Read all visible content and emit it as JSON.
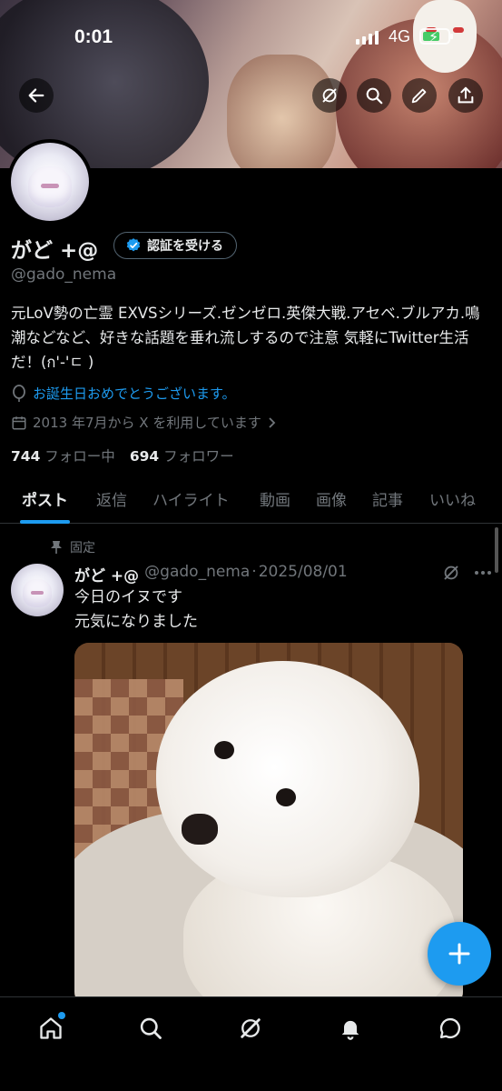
{
  "status_bar": {
    "time": "0:01",
    "network": "4G"
  },
  "profile": {
    "name": "がど +@",
    "verify_label": "認証を受ける",
    "handle": "@gado_nema",
    "bio": "元LoV勢の亡霊 EXVSシリーズ.ゼンゼロ.英傑大戦.アセベ.ブルアカ.鳴潮などなど、好きな話題を垂れ流しするので注意 気軽にTwitter生活だ！(ก'-'ㄷ )",
    "birthday": "お誕生日おめでとうございます。",
    "joined": "2013 年7月から X を利用しています",
    "following_count": "744",
    "following_label": "フォロー中",
    "followers_count": "694",
    "followers_label": "フォロワー"
  },
  "tabs": [
    {
      "label": "ポスト",
      "active": true
    },
    {
      "label": "返信"
    },
    {
      "label": "ハイライト"
    },
    {
      "label": "動画"
    },
    {
      "label": "画像"
    },
    {
      "label": "記事"
    },
    {
      "label": "いいね"
    }
  ],
  "post": {
    "pinned_label": "固定",
    "author": "がど +@",
    "handle": "@gado_nema",
    "separator": "·",
    "date": "2025/08/01",
    "text_line1": "今日のイヌです",
    "text_line2": "元気になりました"
  },
  "colors": {
    "accent": "#1d9bf0",
    "background": "#000000",
    "muted": "#71767b"
  },
  "icons": [
    "back-arrow-icon",
    "grok-icon",
    "search-icon",
    "edit-icon",
    "share-icon",
    "pin-icon",
    "more-icon",
    "home-icon",
    "notifications-icon",
    "messages-icon",
    "plus-icon"
  ]
}
